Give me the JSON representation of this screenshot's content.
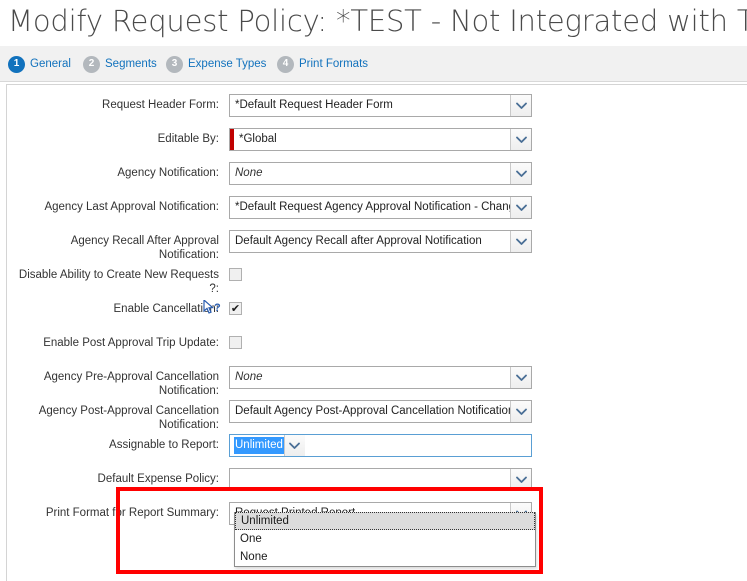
{
  "page": {
    "title": "Modify Request Policy: *TEST - Not Integrated with Travel"
  },
  "tabs": [
    {
      "num": "1",
      "label": "General",
      "active": true
    },
    {
      "num": "2",
      "label": "Segments",
      "active": false
    },
    {
      "num": "3",
      "label": "Expense Types",
      "active": false
    },
    {
      "num": "4",
      "label": "Print Formats",
      "active": false
    }
  ],
  "form": {
    "rows": [
      {
        "label": "",
        "type": "select",
        "value": ""
      },
      {
        "label": "Request Header Form:",
        "type": "select",
        "value": "*Default Request Header Form"
      },
      {
        "label": "Editable By:",
        "type": "select",
        "value": "*Global",
        "required": true
      },
      {
        "label": "Agency Notification:",
        "type": "select",
        "value": "None",
        "italic": true
      },
      {
        "label": "Agency Last Approval Notification:",
        "type": "select",
        "value": "*Default Request Agency Approval Notification - Chang"
      },
      {
        "label": "Agency Recall After Approval\nNotification:",
        "type": "select",
        "value": "Default Agency Recall after Approval Notification"
      },
      {
        "label": "Disable Ability to Create New Requests\n?:",
        "type": "checkbox",
        "checked": false
      },
      {
        "label": "Enable Cancellation:",
        "type": "checkbox",
        "checked": true
      },
      {
        "label": "Enable Post Approval Trip Update:",
        "type": "checkbox",
        "checked": false
      },
      {
        "label": "Agency Pre-Approval Cancellation\nNotification:",
        "type": "select",
        "value": "None",
        "italic": true
      },
      {
        "label": "Agency Post-Approval Cancellation\nNotification:",
        "type": "select",
        "value": "Default Agency Post-Approval Cancellation Notification"
      },
      {
        "label": "Assignable to Report:",
        "type": "select",
        "value": "Unlimited",
        "highlight": true,
        "focused": true
      },
      {
        "label": "Default Expense Policy:",
        "type": "select",
        "value": ""
      },
      {
        "label": "Print Format for Report Summary:",
        "type": "select",
        "value": "Request Printed Report"
      }
    ]
  },
  "dropdown": {
    "open": true,
    "options": [
      {
        "label": "Unlimited",
        "selected": true
      },
      {
        "label": "One",
        "selected": false
      },
      {
        "label": "None",
        "selected": false
      }
    ]
  },
  "icons": {
    "chevron_down": "chevron-down-icon",
    "checkbox_tick": "✔",
    "help_cursor": "?"
  },
  "colors": {
    "accent": "#1272bd",
    "tab_inactive": "#b3b8bd",
    "required_marker": "#c00000",
    "selection_blue": "#3399ff",
    "annotation_red": "#ff0000"
  }
}
